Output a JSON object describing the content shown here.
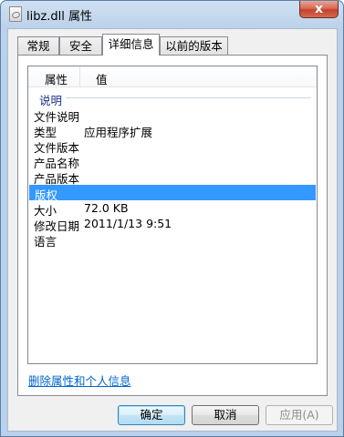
{
  "window": {
    "title": "libz.dll 属性",
    "close_symbol": "x"
  },
  "tabs": [
    {
      "label": "常规",
      "active": false
    },
    {
      "label": "安全",
      "active": false
    },
    {
      "label": "详细信息",
      "active": true
    },
    {
      "label": "以前的版本",
      "active": false
    }
  ],
  "list": {
    "columns": [
      "属性",
      "值"
    ],
    "group": "说明",
    "rows": [
      {
        "name": "文件说明",
        "value": ""
      },
      {
        "name": "类型",
        "value": "应用程序扩展"
      },
      {
        "name": "文件版本",
        "value": ""
      },
      {
        "name": "产品名称",
        "value": ""
      },
      {
        "name": "产品版本",
        "value": ""
      },
      {
        "name": "版权",
        "value": "",
        "selected": true
      },
      {
        "name": "大小",
        "value": "72.0 KB"
      },
      {
        "name": "修改日期",
        "value": "2011/1/13 9:51"
      },
      {
        "name": "语言",
        "value": ""
      }
    ]
  },
  "link": {
    "remove_properties": "删除属性和个人信息"
  },
  "buttons": {
    "ok": "确定",
    "cancel": "取消",
    "apply": "应用(A)"
  },
  "colors": {
    "selection": "#3399ff",
    "link": "#0066cc",
    "group_text": "#1e3287",
    "close_button": "#c4422a"
  }
}
